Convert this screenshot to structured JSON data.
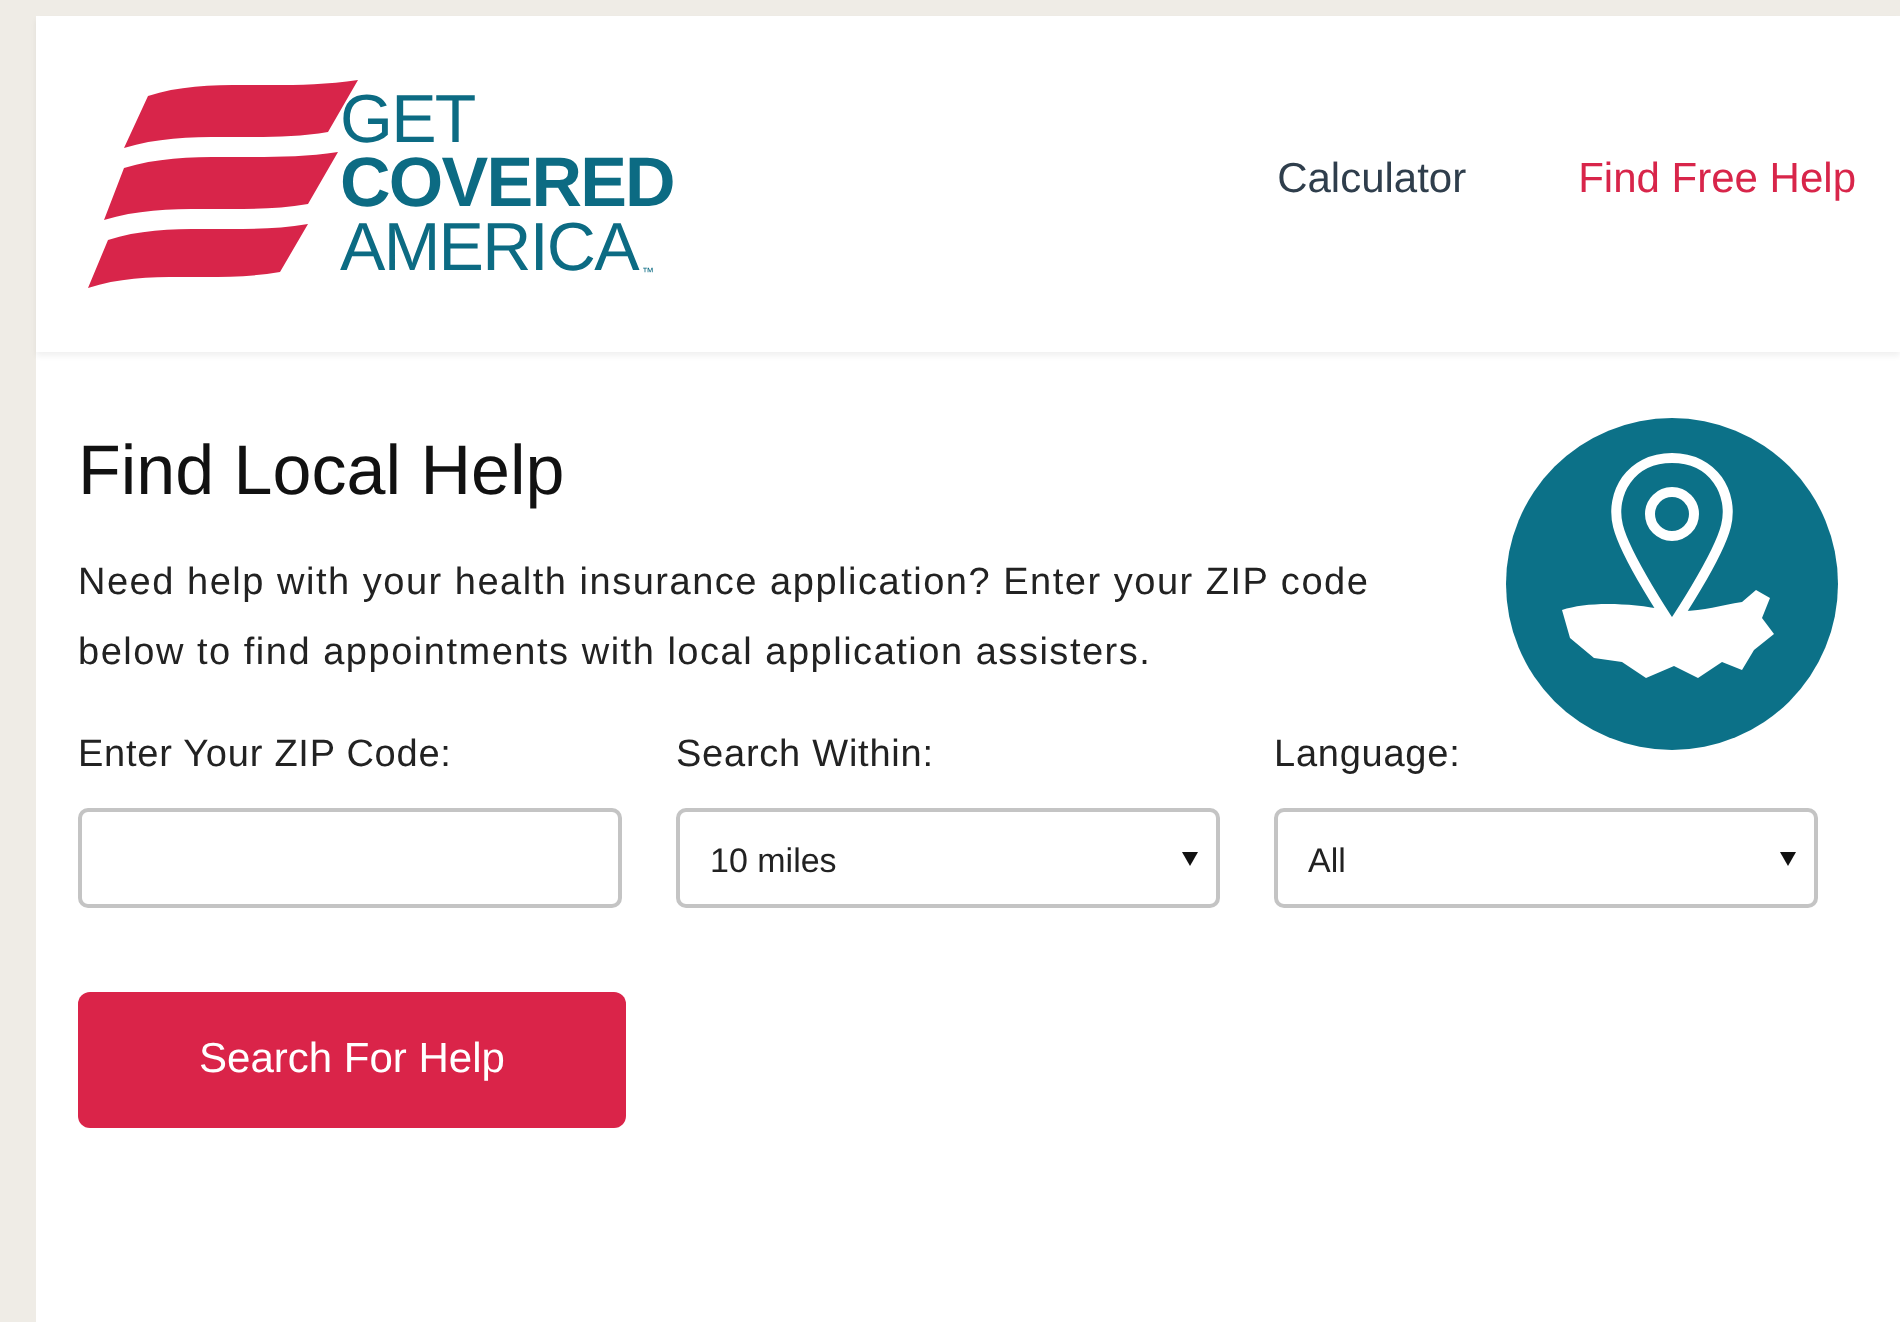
{
  "logo": {
    "line_1": "GET",
    "line_2": "COVERED",
    "line_3": "AMERICA",
    "mark": "™"
  },
  "nav": [
    {
      "label": "Calculator",
      "selected": false
    },
    {
      "label": "Find Free Help",
      "selected": true
    }
  ],
  "heading": "Find Local Help",
  "intro": "Need help with your health insurance application? Enter your ZIP code below to find appointments with local application assisters.",
  "form": [
    {
      "kind": "input",
      "label": "Enter Your ZIP Code:"
    },
    {
      "kind": "select",
      "label": "Search Within:",
      "value": "10 miles"
    },
    {
      "kind": "select",
      "label": "Language:",
      "value": "All"
    }
  ],
  "button": "Search For Help"
}
